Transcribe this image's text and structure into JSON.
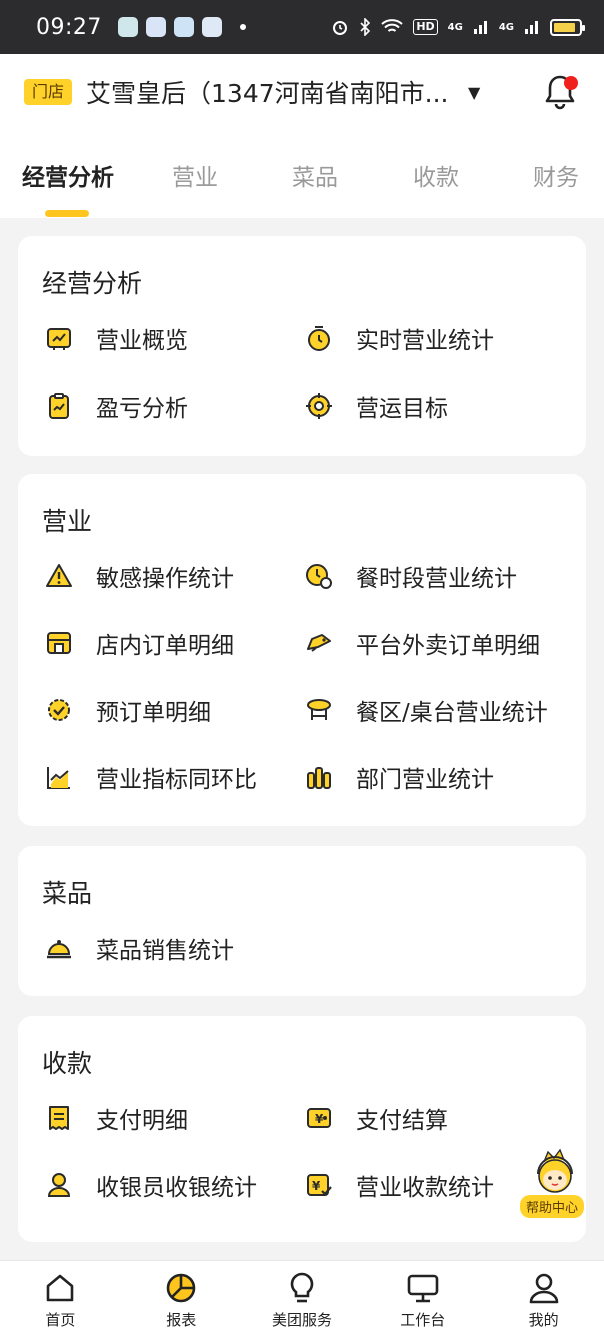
{
  "status_bar": {
    "time": "09:27",
    "network_badge": "HD",
    "signal_labels": [
      "4G",
      "4G"
    ]
  },
  "header": {
    "store_tag": "门店",
    "store_name": "艾雪皇后（1347河南省南阳市...",
    "has_notification": true
  },
  "tabs": [
    {
      "label": "经营分析",
      "active": true
    },
    {
      "label": "营业",
      "active": false
    },
    {
      "label": "菜品",
      "active": false
    },
    {
      "label": "收款",
      "active": false
    },
    {
      "label": "财务",
      "active": false
    }
  ],
  "sections": [
    {
      "title": "经营分析",
      "items": [
        {
          "label": "营业概览",
          "icon": "trend-board-icon"
        },
        {
          "label": "实时营业统计",
          "icon": "timer-icon"
        },
        {
          "label": "盈亏分析",
          "icon": "clipboard-chart-icon"
        },
        {
          "label": "营运目标",
          "icon": "target-icon"
        }
      ]
    },
    {
      "title": "营业",
      "items": [
        {
          "label": "敏感操作统计",
          "icon": "warning-icon"
        },
        {
          "label": "餐时段营业统计",
          "icon": "clock-person-icon"
        },
        {
          "label": "店内订单明细",
          "icon": "store-icon"
        },
        {
          "label": "平台外卖订单明细",
          "icon": "delivery-bike-icon"
        },
        {
          "label": "预订单明细",
          "icon": "check-clock-icon"
        },
        {
          "label": "餐区/桌台营业统计",
          "icon": "table-icon"
        },
        {
          "label": "营业指标同环比",
          "icon": "line-chart-icon"
        },
        {
          "label": "部门营业统计",
          "icon": "department-icon"
        }
      ]
    },
    {
      "title": "菜品",
      "items": [
        {
          "label": "菜品销售统计",
          "icon": "dish-cover-icon"
        }
      ]
    },
    {
      "title": "收款",
      "items": [
        {
          "label": "支付明细",
          "icon": "receipt-icon"
        },
        {
          "label": "支付结算",
          "icon": "yen-card-icon"
        },
        {
          "label": "收银员收银统计",
          "icon": "cashier-icon"
        },
        {
          "label": "营业收款统计",
          "icon": "yen-check-icon"
        }
      ]
    }
  ],
  "help": {
    "label": "帮助中心"
  },
  "bottom_nav": [
    {
      "label": "首页",
      "icon": "home-icon"
    },
    {
      "label": "报表",
      "icon": "report-pie-icon",
      "active": true
    },
    {
      "label": "美团服务",
      "icon": "lightbulb-icon"
    },
    {
      "label": "工作台",
      "icon": "monitor-icon"
    },
    {
      "label": "我的",
      "icon": "profile-icon"
    }
  ],
  "colors": {
    "accent": "#ffc51f",
    "tag_bg": "#ffd22a",
    "notification": "#f0201d",
    "page_bg": "#f3f3f4",
    "icon_stroke": "#2b2b2b"
  }
}
